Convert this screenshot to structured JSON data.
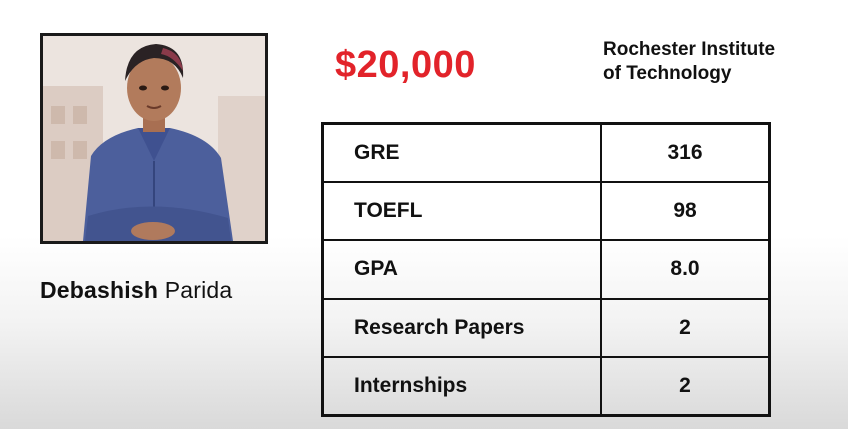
{
  "profile": {
    "first_name": "Debashish",
    "last_name": "Parida",
    "photo": "portrait-photo"
  },
  "scholarship": {
    "amount": "$20,000",
    "university_line1": "Rochester Institute",
    "university_line2": "of Technology"
  },
  "stats": [
    {
      "label": "GRE",
      "value": "316"
    },
    {
      "label": "TOEFL",
      "value": "98"
    },
    {
      "label": "GPA",
      "value": "8.0"
    },
    {
      "label": "Research Papers",
      "value": "2"
    },
    {
      "label": "Internships",
      "value": "2"
    }
  ],
  "colors": {
    "accent": "#e2232a",
    "text": "#111111",
    "border": "#111111"
  }
}
